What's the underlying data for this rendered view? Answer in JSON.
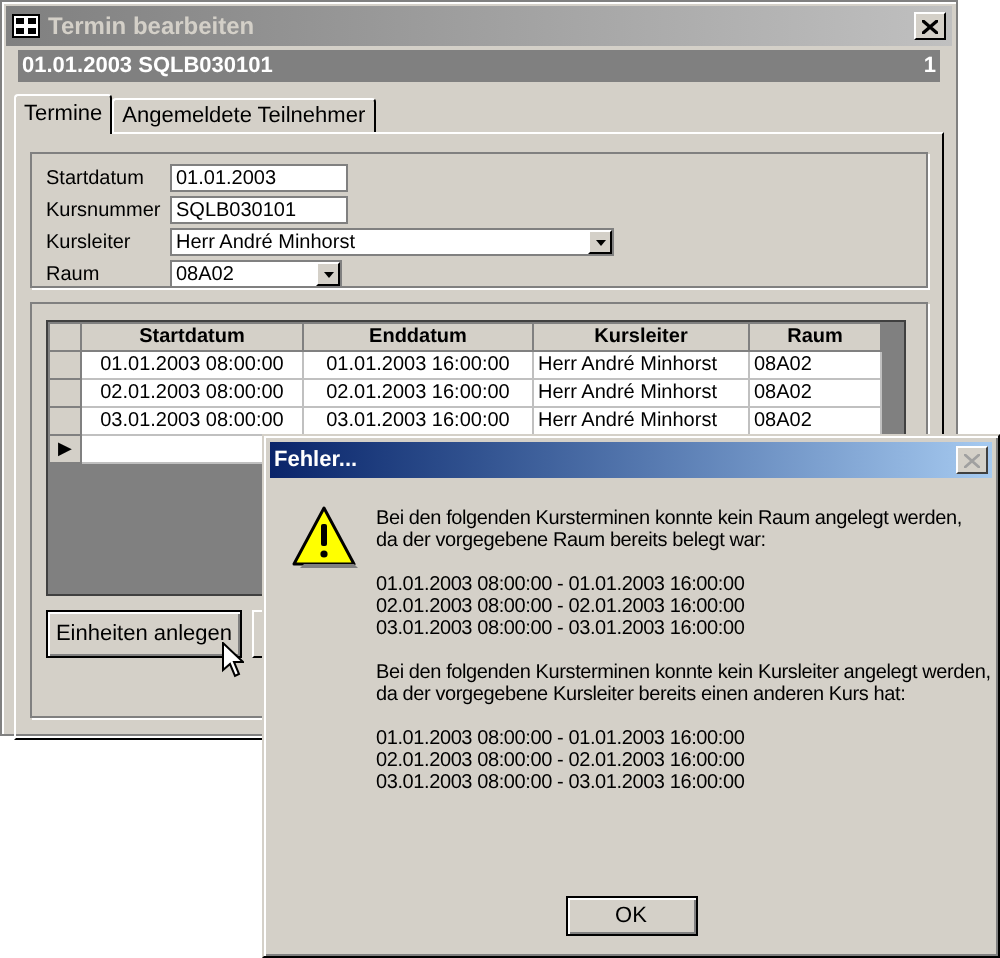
{
  "window": {
    "title": "Termin bearbeiten",
    "header": "01.01.2003 SQLB030101",
    "record_number": "1"
  },
  "tabs": [
    {
      "label": "Termine",
      "selected": true
    },
    {
      "label": "Angemeldete Teilnehmer",
      "selected": false
    }
  ],
  "form": [
    {
      "label": "Startdatum",
      "value": "01.01.2003",
      "kind": "text"
    },
    {
      "label": "Kursnummer",
      "value": "SQLB030101",
      "kind": "text"
    },
    {
      "label": "Kursleiter",
      "value": "Herr André Minhorst",
      "kind": "combo"
    },
    {
      "label": "Raum",
      "value": "08A02",
      "kind": "combo"
    }
  ],
  "table": {
    "columns": [
      "Startdatum",
      "Enddatum",
      "Kursleiter",
      "Raum"
    ],
    "rows": [
      [
        "01.01.2003 08:00:00",
        "01.01.2003 16:00:00",
        "Herr André Minhorst",
        "08A02"
      ],
      [
        "02.01.2003 08:00:00",
        "02.01.2003 16:00:00",
        "Herr André Minhorst",
        "08A02"
      ],
      [
        "03.01.2003 08:00:00",
        "03.01.2003 16:00:00",
        "Herr André Minhorst",
        "08A02"
      ]
    ],
    "new_row_marker": "▶"
  },
  "buttons": [
    "Einheiten anlegen"
  ],
  "dialog": {
    "title": "Fehler...",
    "paragraphs": [
      "Bei den folgenden Kursterminen konnte kein Raum angelegt werden,\nda der vorgegebene Raum bereits belegt war:",
      "01.01.2003 08:00:00 - 01.01.2003 16:00:00\n02.01.2003 08:00:00 - 02.01.2003 16:00:00\n03.01.2003 08:00:00 - 03.01.2003 16:00:00",
      "Bei den folgenden Kursterminen konnte kein Kursleiter angelegt werden,\nda der vorgegebene Kursleiter bereits einen anderen Kurs hat:",
      "01.01.2003 08:00:00 - 01.01.2003 16:00:00\n02.01.2003 08:00:00 - 02.01.2003 16:00:00\n03.01.2003 08:00:00 - 03.01.2003 16:00:00"
    ],
    "button": "OK"
  }
}
